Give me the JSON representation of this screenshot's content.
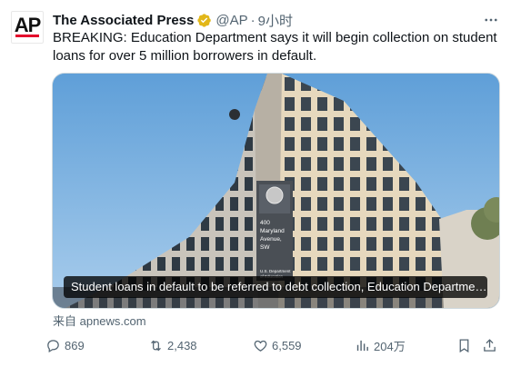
{
  "tweet": {
    "author_name": "The Associated Press",
    "handle": "@AP",
    "separator": "·",
    "time": "9小时",
    "text": "BREAKING: Education Department says it will begin collection on student loans for over 5 million borrowers in default.",
    "avatar_text": "AP"
  },
  "media": {
    "caption": "Student loans in default to be referred to debt collection, Education Departme…",
    "sign_lines": [
      "400",
      "Maryland",
      "Avenue,",
      "SW"
    ],
    "dept_lines": [
      "U.S. Department",
      "of Education"
    ]
  },
  "link_source": "来自 apnews.com",
  "actions": {
    "replies": "869",
    "reposts": "2,438",
    "likes": "6,559",
    "views": "204万"
  },
  "colors": {
    "accent_red": "#e4002b",
    "verified_gold": "#e2b719",
    "muted_text": "#536471",
    "sky": "#7fb6e0"
  }
}
